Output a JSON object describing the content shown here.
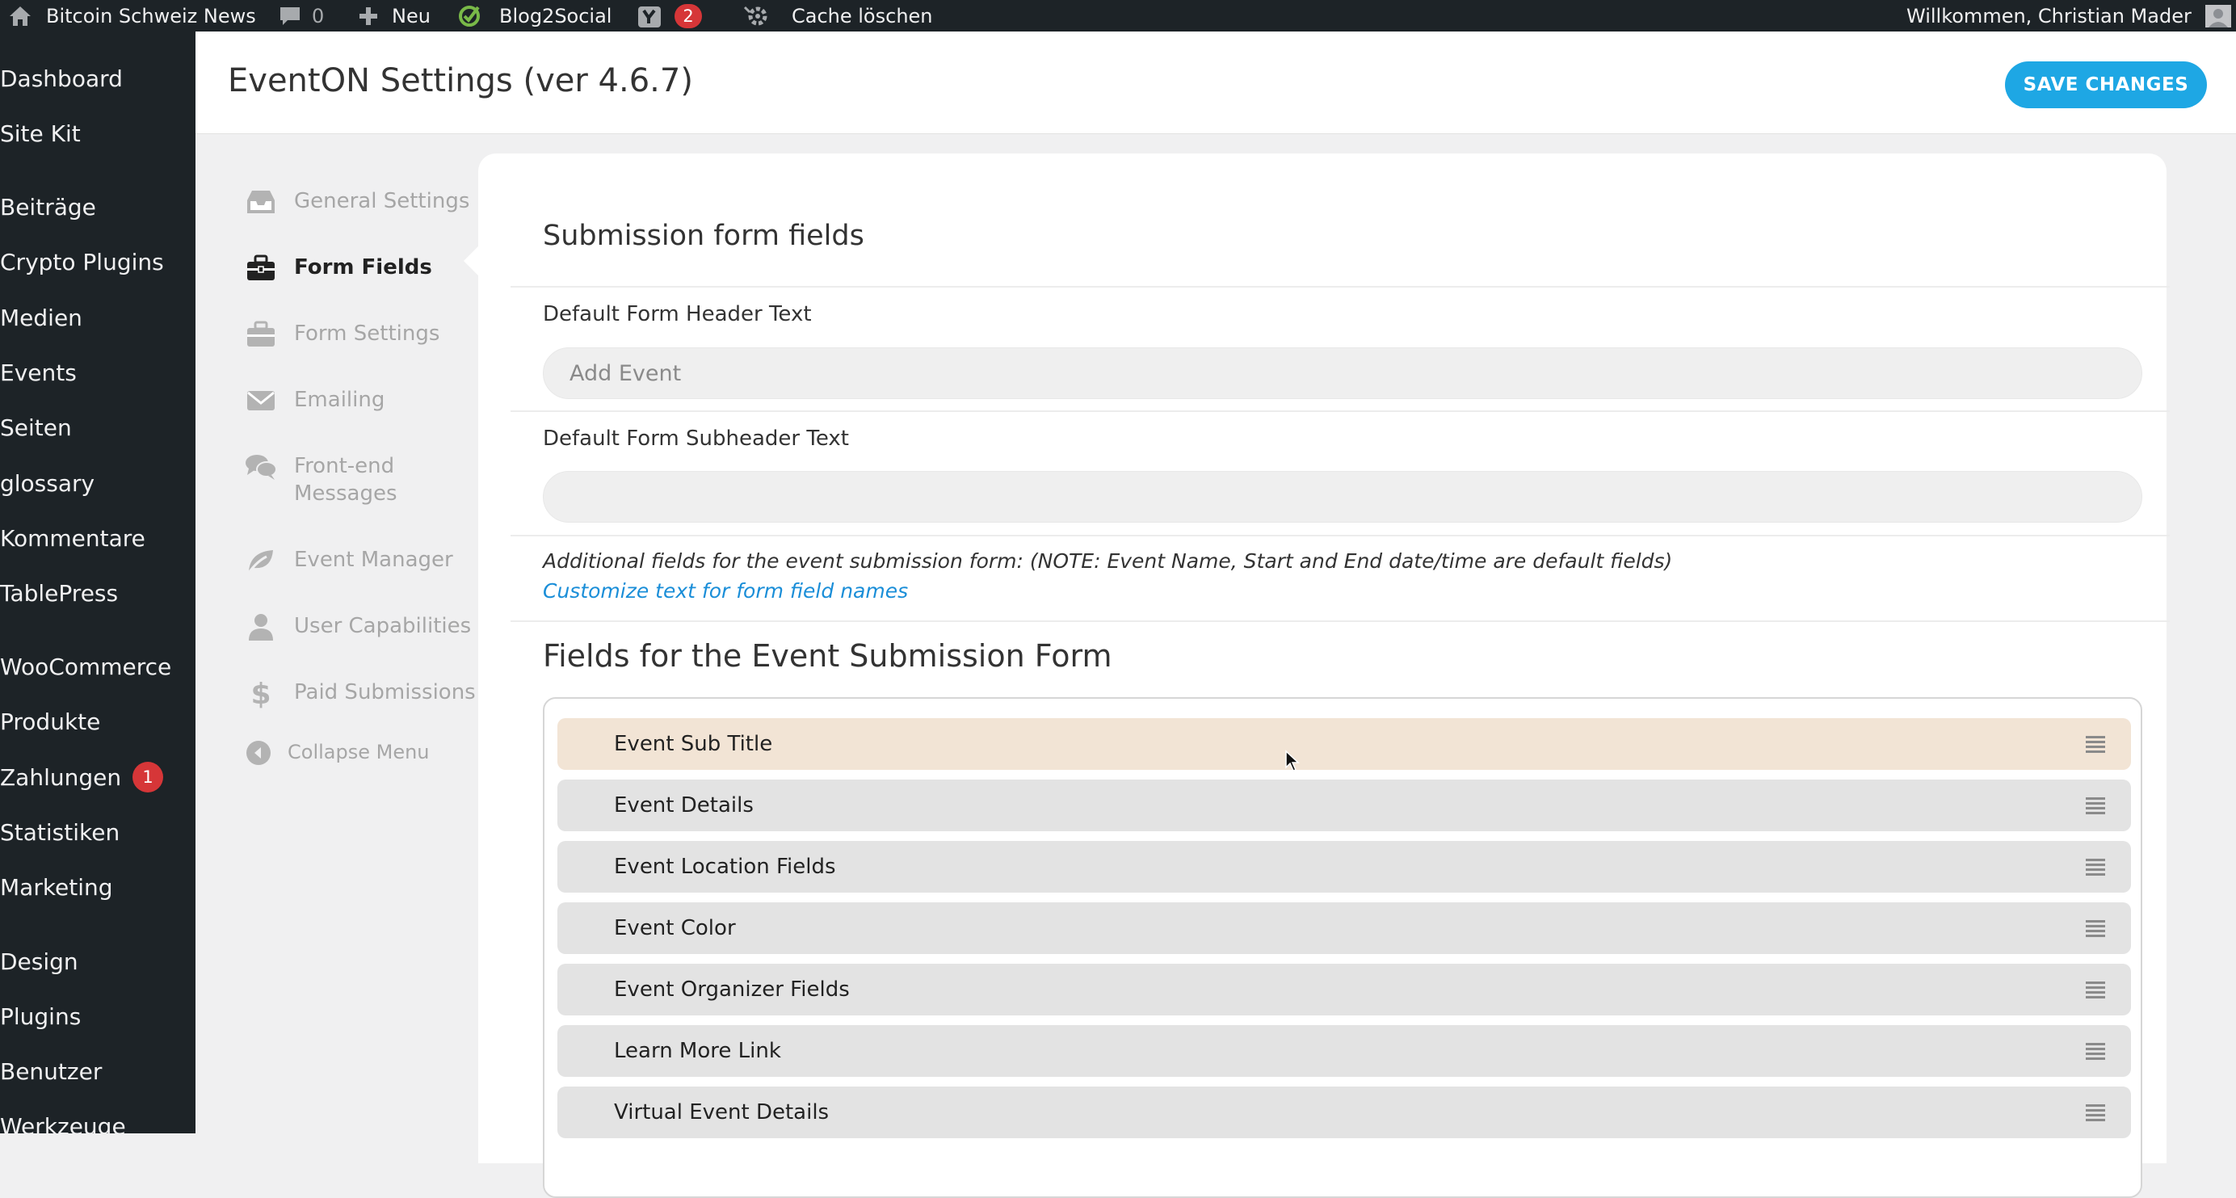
{
  "admin_bar": {
    "site_name": "Bitcoin Schweiz News",
    "comments_count": "0",
    "new_label": "Neu",
    "blog2social_label": "Blog2Social",
    "yoast_badge": "2",
    "cache_label": "Cache löschen",
    "welcome_text": "Willkommen, Christian Mader"
  },
  "admin_menu": {
    "items": [
      {
        "label": "Dashboard"
      },
      {
        "label": "Site Kit"
      },
      {
        "label": "Beiträge"
      },
      {
        "label": "Crypto Plugins"
      },
      {
        "label": "Medien"
      },
      {
        "label": "Events"
      },
      {
        "label": "Seiten"
      },
      {
        "label": "glossary"
      },
      {
        "label": "Kommentare"
      },
      {
        "label": "TablePress"
      },
      {
        "label": "WooCommerce"
      },
      {
        "label": "Produkte"
      },
      {
        "label": "Zahlungen",
        "badge": "1"
      },
      {
        "label": "Statistiken"
      },
      {
        "label": "Marketing"
      },
      {
        "label": "Design"
      },
      {
        "label": "Plugins"
      },
      {
        "label": "Benutzer"
      },
      {
        "label": "Werkzeuge"
      }
    ]
  },
  "header": {
    "title": "EventON Settings (ver 4.6.7)",
    "save_label": "SAVE CHANGES"
  },
  "settings_nav": {
    "items": [
      {
        "label": "General Settings",
        "icon": "inbox-icon"
      },
      {
        "label": "Form Fields",
        "icon": "briefcase-icon",
        "active": true
      },
      {
        "label": "Form Settings",
        "icon": "briefcase-icon"
      },
      {
        "label": "Emailing",
        "icon": "envelope-icon"
      },
      {
        "label": "Front-end Messages",
        "icon": "chat-bubbles-icon"
      },
      {
        "label": "Event Manager",
        "icon": "leaf-icon"
      },
      {
        "label": "User Capabilities",
        "icon": "user-icon"
      },
      {
        "label": "Paid Submissions",
        "icon": "dollar-icon"
      }
    ],
    "collapse_label": "Collapse Menu"
  },
  "content": {
    "section_title": "Submission form fields",
    "header_text": {
      "label": "Default Form Header Text",
      "value": "",
      "placeholder": "Add Event"
    },
    "subheader_text": {
      "label": "Default Form Subheader Text",
      "value": "",
      "placeholder": ""
    },
    "note": "Additional fields for the event submission form: (NOTE: Event Name, Start and End date/time are default fields)",
    "customize_link": "Customize text for form field names",
    "fields_title": "Fields for the Event Submission Form",
    "fields": [
      {
        "label": "Event Sub Title",
        "highlighted": true
      },
      {
        "label": "Event Details"
      },
      {
        "label": "Event Location Fields"
      },
      {
        "label": "Event Color"
      },
      {
        "label": "Event Organizer Fields"
      },
      {
        "label": "Learn More Link"
      },
      {
        "label": "Virtual Event Details"
      }
    ]
  },
  "colors": {
    "admin_dark": "#1d2327",
    "accent_blue": "#1ea7e4",
    "link_blue": "#1a8ed8",
    "badge_red": "#d63638",
    "highlight_row": "#f2e4d5",
    "row_bg": "#e3e3e3"
  }
}
